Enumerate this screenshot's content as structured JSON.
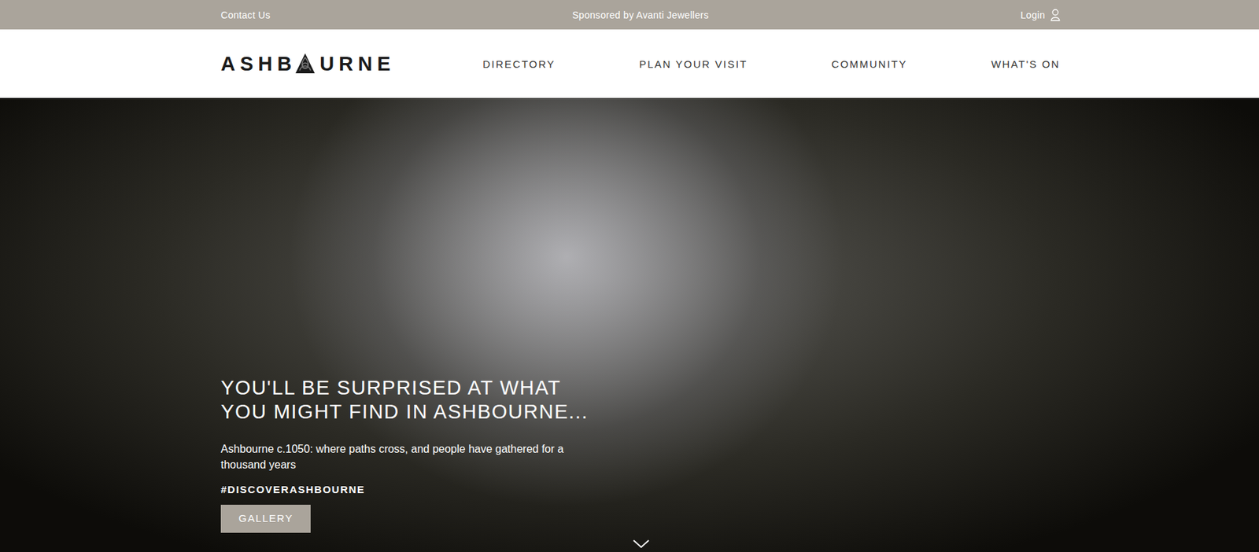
{
  "top_bar": {
    "contact": "Contact Us",
    "sponsor": "Sponsored by Avanti Jewellers",
    "login": "Login"
  },
  "logo": {
    "before": "ASHB",
    "after": "URNE"
  },
  "nav": [
    {
      "label": "DIRECTORY"
    },
    {
      "label": "PLAN YOUR VISIT"
    },
    {
      "label": "COMMUNITY"
    },
    {
      "label": "WHAT'S ON"
    }
  ],
  "hero": {
    "heading": [
      "YOU'LL BE SURPRISED AT WHAT",
      "YOU MIGHT FIND IN ASHBOURNE..."
    ],
    "subtitle": "Ashbourne c.1050: where paths cross, and people have gathered for a thousand years",
    "hashtag": "#DISCOVERASHBOURNE",
    "button": "GALLERY"
  }
}
